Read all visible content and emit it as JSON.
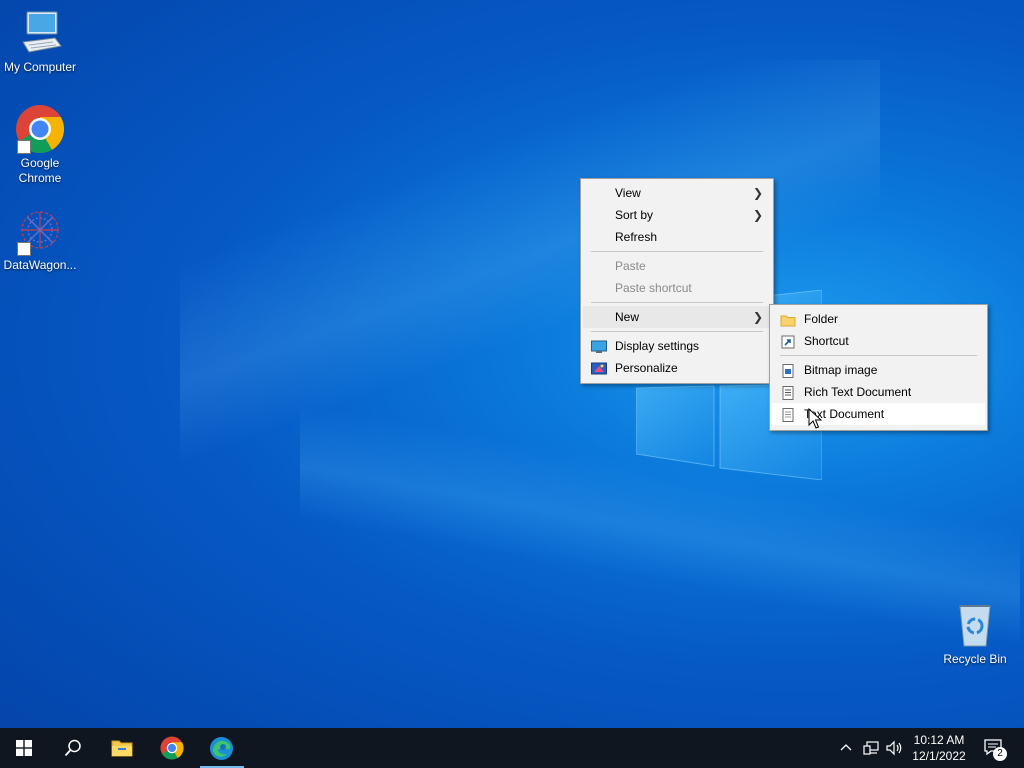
{
  "desktop": {
    "icons": [
      {
        "label": "My Computer",
        "icon": "computer-icon"
      },
      {
        "label": "Google Chrome",
        "icon": "chrome-icon"
      },
      {
        "label": "DataWagon...",
        "icon": "datawagon-icon"
      },
      {
        "label": "Recycle Bin",
        "icon": "recycle-bin-icon"
      }
    ]
  },
  "context_menu": {
    "items": [
      {
        "label": "View",
        "submenu": true
      },
      {
        "label": "Sort by",
        "submenu": true
      },
      {
        "label": "Refresh"
      },
      {
        "label": "Paste",
        "disabled": true
      },
      {
        "label": "Paste shortcut",
        "disabled": true
      },
      {
        "label": "New",
        "submenu": true,
        "hover": true
      },
      {
        "label": "Display settings",
        "icon": "display-icon"
      },
      {
        "label": "Personalize",
        "icon": "personalize-icon"
      }
    ]
  },
  "new_submenu": {
    "items": [
      {
        "label": "Folder",
        "icon": "folder-icon"
      },
      {
        "label": "Shortcut",
        "icon": "shortcut-icon"
      },
      {
        "label": "Bitmap image",
        "icon": "bitmap-icon"
      },
      {
        "label": "Rich Text Document",
        "icon": "rich-text-icon"
      },
      {
        "label": "Text Document",
        "icon": "text-document-icon",
        "highlighted": true
      }
    ]
  },
  "taskbar": {
    "apps": [
      "start-icon",
      "search-icon",
      "file-explorer-icon",
      "chrome-icon",
      "edge-icon"
    ],
    "clock_time": "10:12 AM",
    "clock_date": "12/1/2022",
    "notification_count": "2"
  },
  "colors": {
    "taskbar_bg": "#0f1620",
    "menu_bg": "#f2f2f2",
    "accent": "#0078d7"
  }
}
